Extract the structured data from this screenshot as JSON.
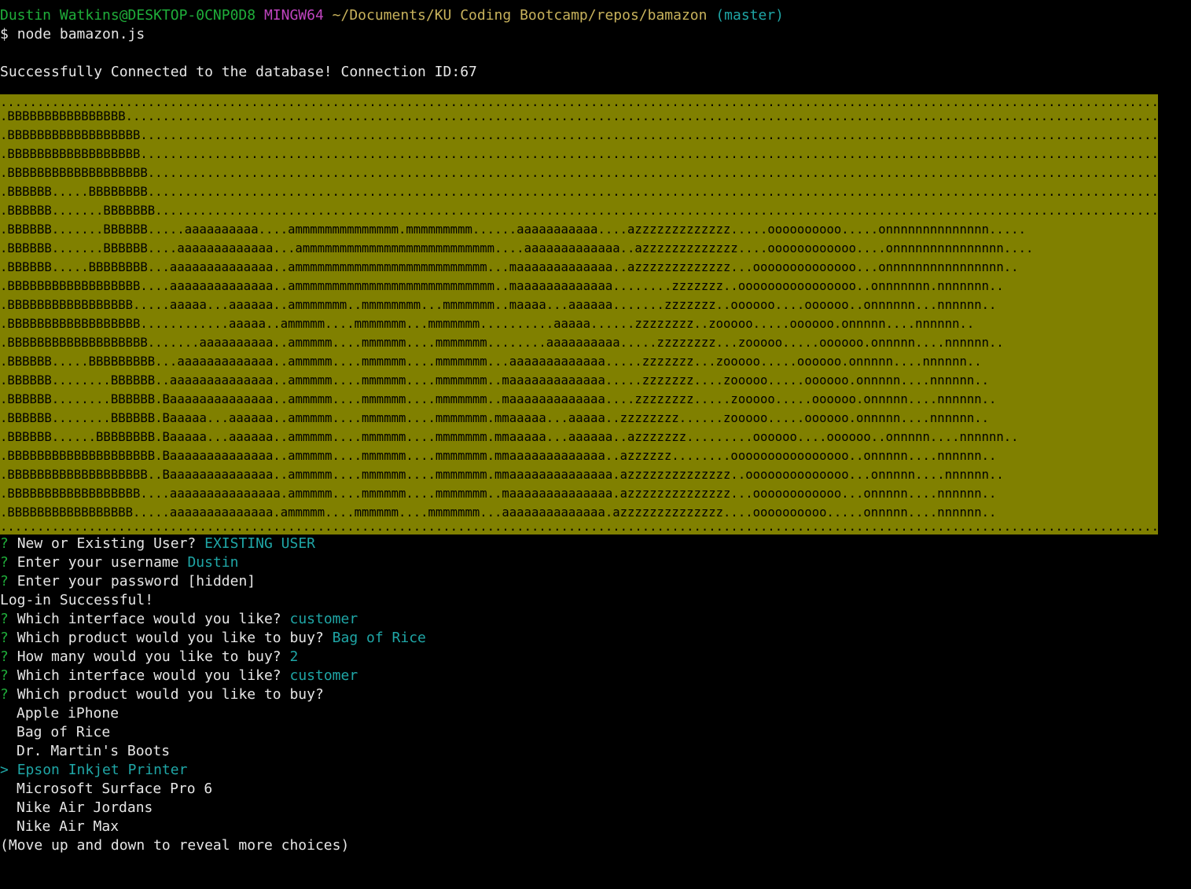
{
  "prompt": {
    "user_host": "Dustin Watkins@DESKTOP-0CNP0D8",
    "shell": "MINGW64",
    "path": "~/Documents/KU Coding Bootcamp/repos/bamazon",
    "branch": "(master)",
    "symbol": "$",
    "command": "node bamazon.js"
  },
  "connection_message": "Successfully Connected to the database! Connection ID:67",
  "banner_lines": [
    "...........................................................................................................................................................................................",
    ".BBBBBBBBBBBBBBBB..........................................................................................................................................................................",
    ".BBBBBBBBBBBBBBBBBB........................................................................................................................................................................",
    ".BBBBBBBBBBBBBBBBBB........................................................................................................................................................................",
    ".BBBBBBBBBBBBBBBBBBB.......................................................................................................................................................................",
    ".BBBBBB.....BBBBBBBB.......................................................................................................................................................................",
    ".BBBBBB.......BBBBBBB......................................................................................................................................................................",
    ".BBBBBB.......BBBBBB.....aaaaaaaaaa....ammmmmmmmmmmmmm.mmmmmmmmm......aaaaaaaaaaa....azzzzzzzzzzzzz.....oooooooooo.....onnnnnnnnnnnnnn.....",
    ".BBBBBB.......BBBBBB....aaaaaaaaaaaaa...ammmmmmmmmmmmmmmmmmmmmmmmmm....aaaaaaaaaaaaa..azzzzzzzzzzzzz....oooooooooooo....onnnnnnnnnnnnnnn....",
    ".BBBBBB.....BBBBBBBB...aaaaaaaaaaaaaa..ammmmmmmmmmmmmmmmmmmmmmmmmm...maaaaaaaaaaaaa..azzzzzzzzzzzzz...oooooooooooooo...onnnnnnnnnnnnnnnn..",
    ".BBBBBBBBBBBBBBBBBB....aaaaaaaaaaaaaa..ammmmmmmmmmmmmmmmmmmmmmmmmmm..maaaaaaaaaaaaa........zzzzzzz..oooooooooooooooo..onnnnnnn.nnnnnnn..",
    ".BBBBBBBBBBBBBBBBB.....aaaaa...aaaaaa..ammmmmmm..mmmmmmmm...mmmmmmm..maaaa...aaaaaa.......zzzzzzz..oooooo....oooooo..onnnnnn...nnnnnn..",
    ".BBBBBBBBBBBBBBBBBB............aaaaa..ammmmm....mmmmmmm...mmmmmmm..........aaaaa......zzzzzzzz..zooooo.....oooooo.onnnnn....nnnnnn..",
    ".BBBBBBBBBBBBBBBBBBB.......aaaaaaaaaa..ammmmm....mmmmmm....mmmmmmm........aaaaaaaaaa.....zzzzzzzz...zooooo.....oooooo.onnnnn....nnnnnn..",
    ".BBBBBB.....BBBBBBBBB...aaaaaaaaaaaaa..ammmmm....mmmmmm....mmmmmmm...aaaaaaaaaaaaa.....zzzzzzz...zooooo.....oooooo.onnnnn....nnnnnn..",
    ".BBBBBB........BBBBBB..aaaaaaaaaaaaaa..ammmmm....mmmmmm....mmmmmmm..maaaaaaaaaaaaa.....zzzzzzz....zooooo.....oooooo.onnnnn....nnnnnn..",
    ".BBBBBB........BBBBBB.Baaaaaaaaaaaaaa..ammmmm....mmmmmm....mmmmmmm..maaaaaaaaaaaaa....zzzzzzzz.....zooooo.....oooooo.onnnnn....nnnnnn..",
    ".BBBBBB........BBBBBB.Baaaaa...aaaaaa..ammmmm....mmmmmm....mmmmmmm.mmaaaaa...aaaaa..zzzzzzzz......zooooo.....oooooo.onnnnn....nnnnnn..",
    ".BBBBBB......BBBBBBBB.Baaaaa...aaaaaa..ammmmm....mmmmmm....mmmmmmm.mmaaaaa...aaaaaa..azzzzzzz.........oooooo....oooooo..onnnnn....nnnnnn..",
    ".BBBBBBBBBBBBBBBBBBBB.Baaaaaaaaaaaaaa..ammmmm....mmmmmm....mmmmmmm.mmaaaaaaaaaaaaa..azzzzzz........oooooooooooooooo..onnnnn....nnnnnn..",
    ".BBBBBBBBBBBBBBBBBBB..Baaaaaaaaaaaaaa..ammmmm....mmmmmm....mmmmmmm.mmaaaaaaaaaaaaaa.azzzzzzzzzzzzzz..oooooooooooooo...onnnnn....nnnnnn..",
    ".BBBBBBBBBBBBBBBBBB....aaaaaaaaaaaaaaa.ammmmm....mmmmmm....mmmmmmm..maaaaaaaaaaaaaa.azzzzzzzzzzzzzz...oooooooooooo...onnnnn....nnnnnn..",
    ".BBBBBBBBBBBBBBBBB.....aaaaaaaaaaaaaa.ammmmm....mmmmmm....mmmmmmm...aaaaaaaaaaaaaa.azzzzzzzzzzzzzz....oooooooooo.....onnnnn....nnnnnn..",
    "...........................................................................................................................................................................................",
    "..........................................................................................................................................................................................."
  ],
  "session": [
    {
      "mark": "?",
      "question": "New or Existing User?",
      "answer": "EXISTING USER",
      "answer_color": "cyan"
    },
    {
      "mark": "?",
      "question": "Enter your username",
      "answer": "Dustin",
      "answer_color": "cyan"
    },
    {
      "mark": "?",
      "question": "Enter your password",
      "answer": "[hidden]",
      "answer_color": "white"
    }
  ],
  "login_message": "Log-in Successful!",
  "session2": [
    {
      "mark": "?",
      "question": "Which interface would you like?",
      "answer": "customer"
    },
    {
      "mark": "?",
      "question": "Which product would you like to buy?",
      "answer": "Bag of Rice"
    },
    {
      "mark": "?",
      "question": "How many would you like to buy?",
      "answer": "2"
    },
    {
      "mark": "?",
      "question": "Which interface would you like?",
      "answer": "customer"
    },
    {
      "mark": "?",
      "question": "Which product would you like to buy?",
      "answer": ""
    }
  ],
  "product_list": {
    "pointer": ">",
    "items": [
      {
        "label": "Apple iPhone",
        "selected": false
      },
      {
        "label": "Bag of Rice",
        "selected": false
      },
      {
        "label": "Dr. Martin's Boots",
        "selected": false
      },
      {
        "label": "Epson Inkjet Printer",
        "selected": true
      },
      {
        "label": "Microsoft Surface Pro 6",
        "selected": false
      },
      {
        "label": "Nike Air Jordans",
        "selected": false
      },
      {
        "label": "Nike Air Max",
        "selected": false
      }
    ],
    "hint": "(Move up and down to reveal more choices)"
  },
  "colors": {
    "background": "#000000",
    "banner_bg": "#808000",
    "green": "#1fae3a",
    "magenta": "#c044c0",
    "yellow": "#c8b25c",
    "cyan": "#1fa6a6",
    "text": "#e6e6e6"
  }
}
